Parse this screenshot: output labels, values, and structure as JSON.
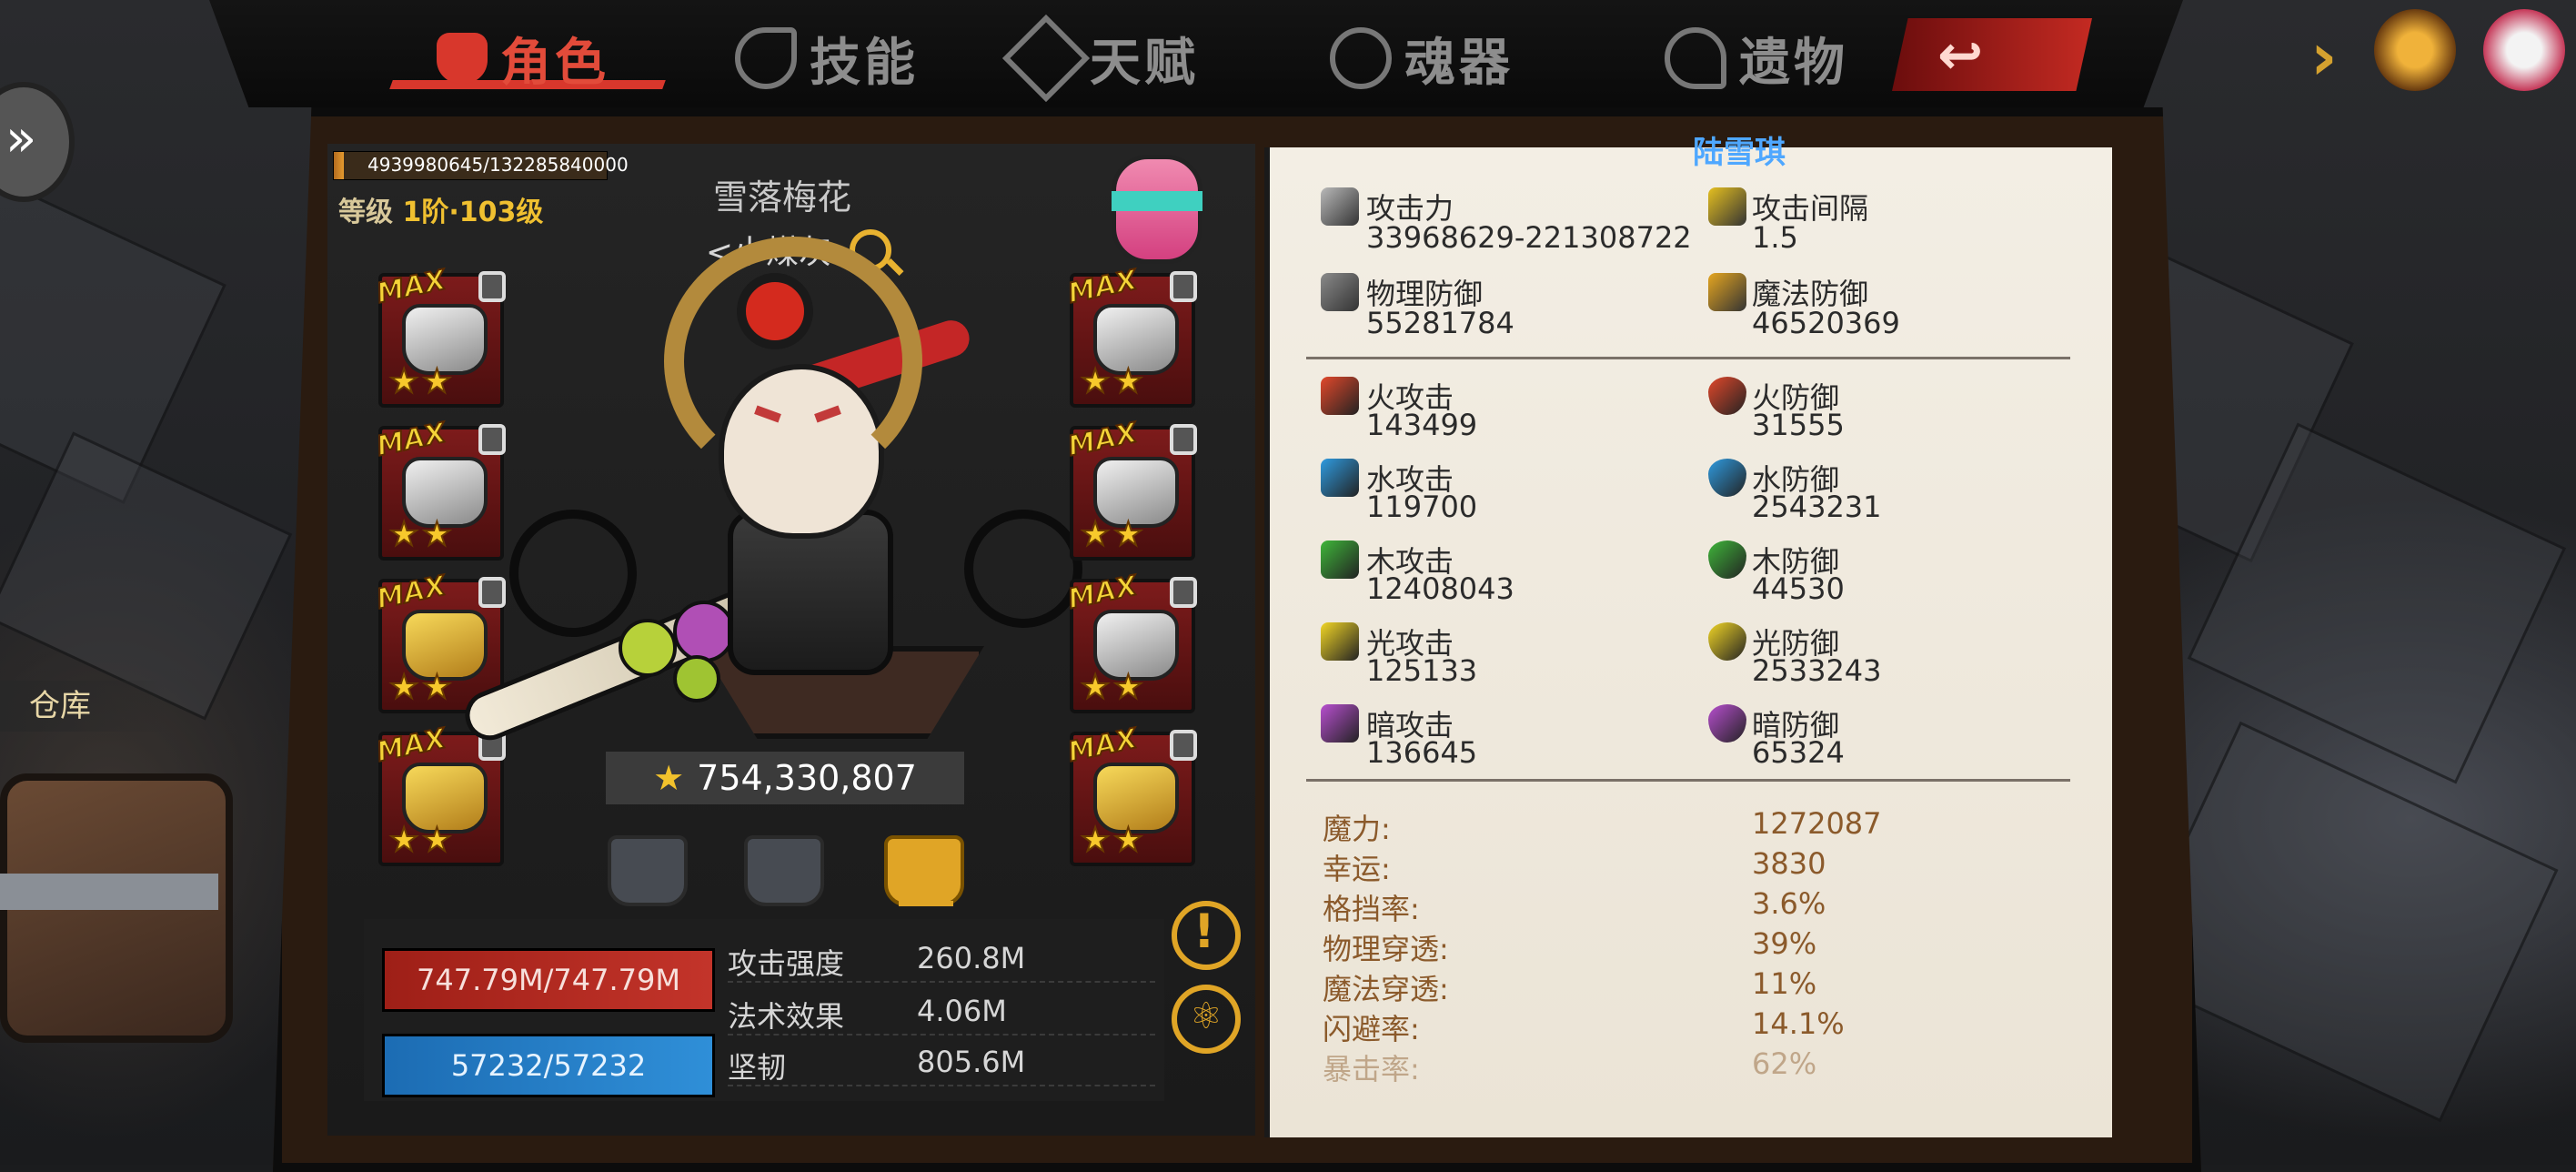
{
  "tabs": [
    {
      "label": "角色",
      "active": true,
      "icon": "devil-icon"
    },
    {
      "label": "技能",
      "active": false,
      "icon": "skill-icon"
    },
    {
      "label": "天赋",
      "active": false,
      "icon": "talent-icon"
    },
    {
      "label": "魂器",
      "active": false,
      "icon": "soul-icon"
    },
    {
      "label": "遗物",
      "active": false,
      "icon": "relic-icon"
    }
  ],
  "side": {
    "warehouse": "仓库"
  },
  "character": {
    "exp_text": "4939980645/132285840000",
    "exp_fraction": 0.037,
    "level_label": "等级",
    "level_value": "1阶·103级",
    "title_line": "雪落梅花",
    "nickname": "<小煤灰>",
    "power": "754,330,807",
    "equipment_left": [
      {
        "label": "MAX",
        "stars": "★★"
      },
      {
        "label": "MAX",
        "stars": "★★"
      },
      {
        "label": "MAX",
        "stars": "★★"
      },
      {
        "label": "MAX",
        "stars": "★★"
      }
    ],
    "equipment_right": [
      {
        "label": "MAX",
        "stars": "★★"
      },
      {
        "label": "MAX",
        "stars": "★★"
      },
      {
        "label": "MAX",
        "stars": "★★"
      },
      {
        "label": "MAX",
        "stars": "★★"
      }
    ],
    "hp": "747.79M/747.79M",
    "mp": "57232/57232",
    "attrs": [
      {
        "label": "攻击强度",
        "value": "260.8M"
      },
      {
        "label": "法术效果",
        "value": "4.06M"
      },
      {
        "label": "坚韧",
        "value": "805.6M"
      }
    ]
  },
  "stats": {
    "name": "陆雪琪",
    "primary": [
      {
        "label": "攻击力",
        "value": "33968629-221308722",
        "color": "#b9b9b9"
      },
      {
        "label": "攻击间隔",
        "value": "1.5",
        "color": "#e6c020"
      },
      {
        "label": "物理防御",
        "value": "55281784",
        "color": "#8a8a8a"
      },
      {
        "label": "魔法防御",
        "value": "46520369",
        "color": "#e6a620"
      }
    ],
    "elements": [
      {
        "label": "火攻击",
        "value": "143499",
        "color": "#e2482b"
      },
      {
        "label": "火防御",
        "value": "31555",
        "color": "#e2482b"
      },
      {
        "label": "水攻击",
        "value": "119700",
        "color": "#2f9be0"
      },
      {
        "label": "水防御",
        "value": "2543231",
        "color": "#2f9be0"
      },
      {
        "label": "木攻击",
        "value": "12408043",
        "color": "#3fb63a"
      },
      {
        "label": "木防御",
        "value": "44530",
        "color": "#3fb63a"
      },
      {
        "label": "光攻击",
        "value": "125133",
        "color": "#f2d626"
      },
      {
        "label": "光防御",
        "value": "2533243",
        "color": "#f2d626"
      },
      {
        "label": "暗攻击",
        "value": "136645",
        "color": "#b84fd0"
      },
      {
        "label": "暗防御",
        "value": "65324",
        "color": "#b84fd0"
      }
    ],
    "secondary": [
      {
        "label": "魔力:",
        "value": "1272087"
      },
      {
        "label": "幸运:",
        "value": "3830"
      },
      {
        "label": "格挡率:",
        "value": "3.6%"
      },
      {
        "label": "物理穿透:",
        "value": "39%"
      },
      {
        "label": "魔法穿透:",
        "value": "11%"
      },
      {
        "label": "闪避率:",
        "value": "14.1%"
      },
      {
        "label": "暴击率:",
        "value": "62%"
      }
    ]
  },
  "colors": {
    "accent_red": "#d8372c",
    "gold": "#e0a526",
    "name_blue": "#4ea7ff"
  }
}
